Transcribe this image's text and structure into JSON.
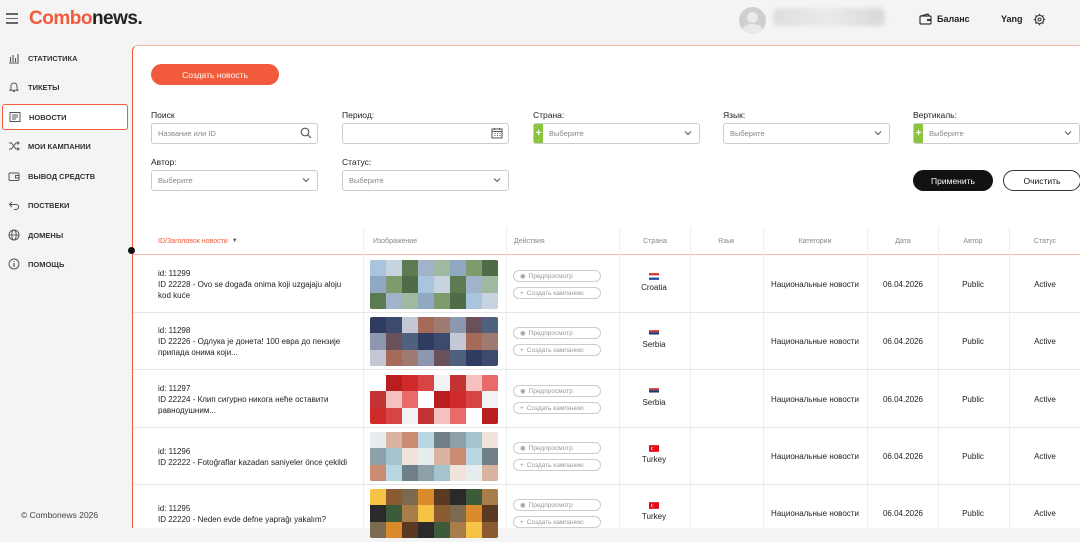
{
  "logo": {
    "part1": "Combo",
    "part2": "news."
  },
  "header": {
    "balance_label": "Баланс",
    "username": "Yang"
  },
  "sidebar": {
    "items": [
      {
        "label": "Статистика",
        "icon": "chart-icon"
      },
      {
        "label": "Тикеты",
        "icon": "bell-icon"
      },
      {
        "label": "Новости",
        "icon": "news-icon",
        "active": true
      },
      {
        "label": "Мои кампании",
        "icon": "shuffle-icon"
      },
      {
        "label": "Вывод средств",
        "icon": "wallet-icon"
      },
      {
        "label": "Поствеки",
        "icon": "back-arrow-icon"
      },
      {
        "label": "Домены",
        "icon": "globe-icon"
      },
      {
        "label": "Помощь",
        "icon": "info-icon"
      }
    ],
    "copyright": "© Combonews 2026"
  },
  "main": {
    "create_button": "Создать новость"
  },
  "filters": {
    "search": {
      "label": "Поиск",
      "placeholder": "Название или ID"
    },
    "period": {
      "label": "Период:",
      "value": ""
    },
    "country": {
      "label": "Страна:",
      "value": "Выберите"
    },
    "language": {
      "label": "Язык:",
      "value": "Выберите"
    },
    "vertical": {
      "label": "Вертикаль:",
      "value": "Выберите"
    },
    "author": {
      "label": "Автор:",
      "value": "Выберите"
    },
    "status": {
      "label": "Статус:",
      "value": "Выберите"
    },
    "apply": "Применить",
    "clear": "Очистить"
  },
  "table": {
    "headers": {
      "id": "ID/Заголовок новости",
      "image": "Изображение",
      "actions": "Действия",
      "country": "Страна",
      "language": "Язык",
      "categories": "Категории",
      "date": "Дата",
      "author": "Автор",
      "status": "Статус"
    },
    "preview_label": "Предпросмотр",
    "campaign_label": "Создать кампанию",
    "rows": [
      {
        "id": "id: 11299",
        "title": "ID 22228 - Ovo se događa onima koji uzgajaju aloju kod kuće",
        "country": "Croatia",
        "flag": "hr",
        "category": "Национальные новости",
        "date": "06.04.2026",
        "author": "Public",
        "status": "Active"
      },
      {
        "id": "id: 11298",
        "title": "ID 22226 - Одлука је донета! 100 евра до пензије припада онима који...",
        "country": "Serbia",
        "flag": "rs",
        "category": "Национальные новости",
        "date": "06.04.2026",
        "author": "Public",
        "status": "Active"
      },
      {
        "id": "id: 11297",
        "title": "ID 22224 - Клип сигурно никога неће оставити равнодушним...",
        "country": "Serbia",
        "flag": "rs",
        "category": "Национальные новости",
        "date": "06.04.2026",
        "author": "Public",
        "status": "Active"
      },
      {
        "id": "id: 11296",
        "title": "ID 22222 - Fotoğraflar kazadan saniyeler önce çekildi",
        "country": "Turkey",
        "flag": "tr",
        "category": "Национальные новости",
        "date": "06.04.2026",
        "author": "Public",
        "status": "Active"
      },
      {
        "id": "id: 11295",
        "title": "ID 22220 - Neden evde defne yaprağı yakalım?",
        "country": "Turkey",
        "flag": "tr",
        "category": "Национальные новости",
        "date": "06.04.2026",
        "author": "Public",
        "status": "Active"
      }
    ]
  },
  "colors": {
    "accent": "#f15a3a",
    "green": "#8bc53f",
    "dark": "#111111"
  }
}
